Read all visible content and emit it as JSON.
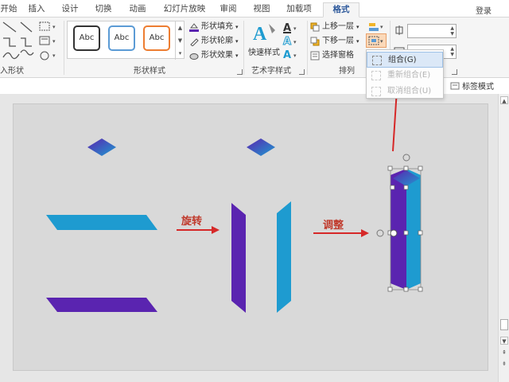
{
  "tabs": [
    {
      "label": "开始",
      "active": false
    },
    {
      "label": "插入",
      "active": false
    },
    {
      "label": "设计",
      "active": false
    },
    {
      "label": "切换",
      "active": false
    },
    {
      "label": "动画",
      "active": false
    },
    {
      "label": "幻灯片放映",
      "active": false
    },
    {
      "label": "审阅",
      "active": false
    },
    {
      "label": "视图",
      "active": false
    },
    {
      "label": "加载项",
      "active": false
    },
    {
      "label": "格式",
      "active": true
    }
  ],
  "login_label": "登录",
  "ribbon": {
    "insert_shapes_label": "入形状",
    "shape_styles": {
      "group_label": "形状样式",
      "styles": [
        {
          "label": "Abc",
          "color": "#333333"
        },
        {
          "label": "Abc",
          "color": "#5b9bd5"
        },
        {
          "label": "Abc",
          "color": "#ed7d31"
        }
      ],
      "fill_label": "形状填充",
      "outline_label": "形状轮廓",
      "effect_label": "形状效果"
    },
    "wordart": {
      "quick_styles_label": "快速样式",
      "group_label": "艺术字样式"
    },
    "arrange": {
      "bring_forward_label": "上移一层",
      "send_backward_label": "下移一层",
      "selection_pane_label": "选择窗格",
      "group_label": "排列"
    },
    "tag_mode_label": "标签模式"
  },
  "group_menu": {
    "items": [
      {
        "label": "组合(G)",
        "enabled": true,
        "highlighted": true
      },
      {
        "label": "重新组合(E)",
        "enabled": false,
        "highlighted": false
      },
      {
        "label": "取消组合(U)",
        "enabled": false,
        "highlighted": false
      }
    ]
  },
  "slide": {
    "label_rotate": "旋转",
    "label_adjust": "调整"
  },
  "colors": {
    "accent": "#2b579a",
    "purple": "#5a24b0",
    "cyan": "#1e9bd0",
    "arrow_red": "#d62828"
  }
}
